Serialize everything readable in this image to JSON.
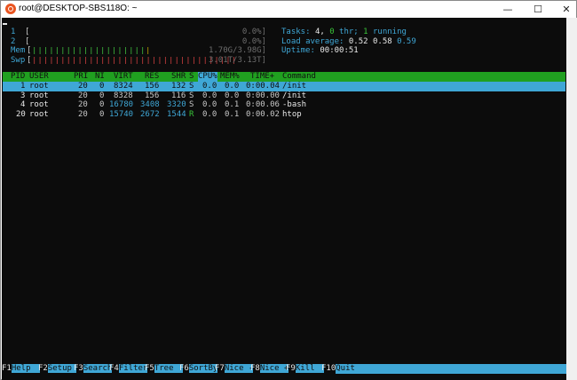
{
  "window": {
    "title": "root@DESKTOP-SBS118O: ~",
    "minimize": "—",
    "maximize": "☐",
    "close": "✕"
  },
  "meters": {
    "cpu1": {
      "label": "1",
      "value": "0.0%]"
    },
    "cpu2": {
      "label": "2",
      "value": "0.0%]"
    },
    "mem": {
      "label": "Mem",
      "value": "1.70G/3.98G]"
    },
    "swp": {
      "label": "Swp",
      "value": "3.01T/3.13T]"
    }
  },
  "summary": {
    "tasks_label": "Tasks:",
    "tasks_count": "4,",
    "thr_count": "0",
    "thr_label": "thr;",
    "running_count": "1",
    "running_label": "running",
    "load_label": "Load average:",
    "load1": "0.52",
    "load5": "0.58",
    "load15": "0.59",
    "uptime_label": "Uptime:",
    "uptime": "00:00:51"
  },
  "columns": [
    "PID",
    "USER",
    "PRI",
    "NI",
    "VIRT",
    "RES",
    "SHR",
    "S",
    "CPU%",
    "MEM%",
    "TIME+",
    "Command"
  ],
  "processes": [
    {
      "pid": "1",
      "user": "root",
      "pri": "20",
      "ni": "0",
      "virt": "8324",
      "res": "156",
      "shr": "132",
      "s": "S",
      "cpu": "0.0",
      "mem": "0.0",
      "time": "0:00.04",
      "cmd": "/init"
    },
    {
      "pid": "3",
      "user": "root",
      "pri": "20",
      "ni": "0",
      "virt": "8328",
      "res": "156",
      "shr": "116",
      "s": "S",
      "cpu": "0.0",
      "mem": "0.0",
      "time": "0:00.00",
      "cmd": "/init"
    },
    {
      "pid": "4",
      "user": "root",
      "pri": "20",
      "ni": "0",
      "virt": "16780",
      "res": "3408",
      "shr": "3320",
      "s": "S",
      "cpu": "0.0",
      "mem": "0.1",
      "time": "0:00.06",
      "cmd": "-bash"
    },
    {
      "pid": "20",
      "user": "root",
      "pri": "20",
      "ni": "0",
      "virt": "15740",
      "res": "2672",
      "shr": "1544",
      "s": "R",
      "cpu": "0.0",
      "mem": "0.1",
      "time": "0:00.02",
      "cmd": "htop"
    }
  ],
  "fkeys": [
    {
      "key": "F1",
      "label": "Help  "
    },
    {
      "key": "F2",
      "label": "Setup "
    },
    {
      "key": "F3",
      "label": "Search"
    },
    {
      "key": "F4",
      "label": "Filter"
    },
    {
      "key": "F5",
      "label": "Tree  "
    },
    {
      "key": "F6",
      "label": "SortBy"
    },
    {
      "key": "F7",
      "label": "Nice -"
    },
    {
      "key": "F8",
      "label": "Nice +"
    },
    {
      "key": "F9",
      "label": "Kill  "
    },
    {
      "key": "F10",
      "label": "Quit  "
    }
  ],
  "colors": {
    "terminal_bg": "#0c0c0c",
    "header_green": "#20a020",
    "highlight_blue": "#3fa7d6",
    "bar_green": "#3fbf3f",
    "bar_yellow": "#c0a000",
    "swap_red": "#d14040"
  }
}
